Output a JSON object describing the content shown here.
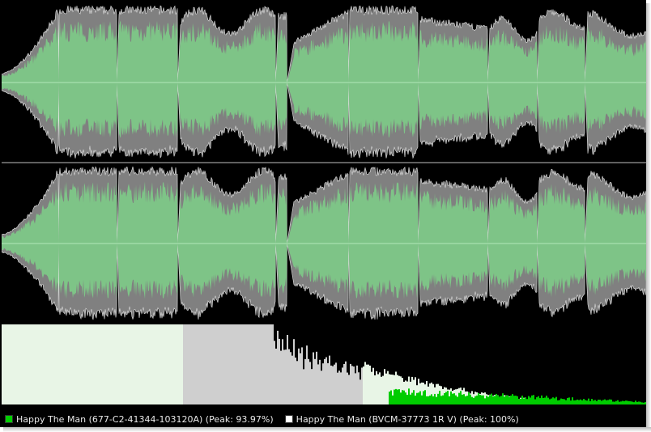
{
  "legend": {
    "item1": {
      "label": "Happy The Man (677-C2-41344-103120A) (Peak: 93.97%)",
      "color": "#00d000"
    },
    "item2": {
      "label": "Happy The Man (BVCM-37773 1R V) (Peak: 100%)",
      "color": "#ffffff"
    }
  },
  "colors": {
    "background": "#000000",
    "waveform_outer": "#808080",
    "waveform_outer_outline": "#e6e6e6",
    "waveform_inner": "#7ec487",
    "centerline": "#a8e0b0",
    "divider": "#9a9a9a",
    "spectrum_white": "#e8f5e6",
    "spectrum_green": "#00cc00"
  },
  "waveform": {
    "channels": [
      "left",
      "right"
    ],
    "track_breaks_visible": true
  }
}
